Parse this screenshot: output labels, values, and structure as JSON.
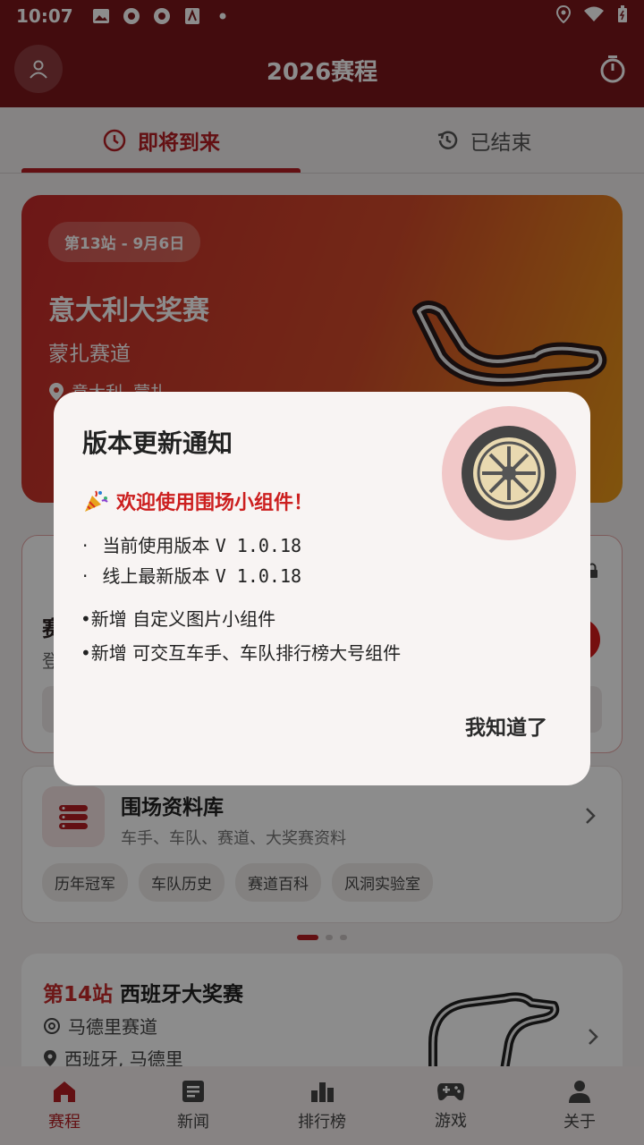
{
  "status_bar": {
    "time": "10:07"
  },
  "header": {
    "title": "2026赛程"
  },
  "tabs": [
    {
      "label": "即将到来",
      "icon": "clock-icon",
      "active": true
    },
    {
      "label": "已结束",
      "icon": "history-icon",
      "active": false
    }
  ],
  "hero": {
    "chip": "第13站 - 9月6日",
    "grand_prix": "意大利大奖赛",
    "circuit": "蒙扎赛道",
    "location": "意大利, 蒙扎"
  },
  "middle_card": {
    "title_fragment": "赛",
    "subtitle_fragment": "登"
  },
  "database": {
    "title": "围场资料库",
    "subtitle": "车手、车队、赛道、大奖赛资料",
    "tags": [
      "历年冠军",
      "车队历史",
      "赛道百科",
      "风洞实验室"
    ]
  },
  "next_race": {
    "stage": "第14站",
    "grand_prix": "西班牙大奖赛",
    "circuit": "马德里赛道",
    "location": "西班牙, 马德里"
  },
  "bottom_nav": [
    {
      "label": "赛程",
      "icon": "home-icon",
      "active": true
    },
    {
      "label": "新闻",
      "icon": "news-icon",
      "active": false
    },
    {
      "label": "排行榜",
      "icon": "leaderboard-icon",
      "active": false
    },
    {
      "label": "游戏",
      "icon": "gamepad-icon",
      "active": false
    },
    {
      "label": "关于",
      "icon": "person-icon",
      "active": false
    }
  ],
  "dialog": {
    "title": "版本更新通知",
    "welcome": "欢迎使用围场小组件！",
    "current_version_label": "当前使用版本",
    "current_version": "V 1.0.18",
    "latest_version_label": "线上最新版本",
    "latest_version": "V 1.0.18",
    "features": [
      "•新增 自定义图片小组件",
      "•新增 可交互车手、车队排行榜大号组件"
    ],
    "confirm": "我知道了"
  },
  "colors": {
    "brand": "#7a171b",
    "accent": "#b41e24"
  }
}
